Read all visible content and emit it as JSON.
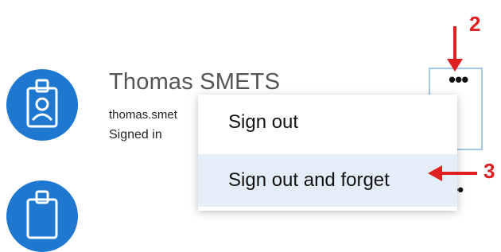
{
  "accounts": [
    {
      "name": "Thomas SMETS",
      "email": "thomas.smet",
      "status": "Signed in",
      "avatar_icon": "id-badge-icon",
      "avatar_color": "#1f78d0"
    },
    {
      "name": "",
      "avatar_icon": "id-badge-icon",
      "avatar_color": "#1f78d0"
    }
  ],
  "more_button": {
    "icon": "more-options-icon",
    "glyph": "•••"
  },
  "context_menu": {
    "items": [
      "Sign out",
      "Sign out and forget"
    ]
  },
  "annotations": {
    "step2": "2",
    "step3": "3",
    "color": "#e02020"
  }
}
